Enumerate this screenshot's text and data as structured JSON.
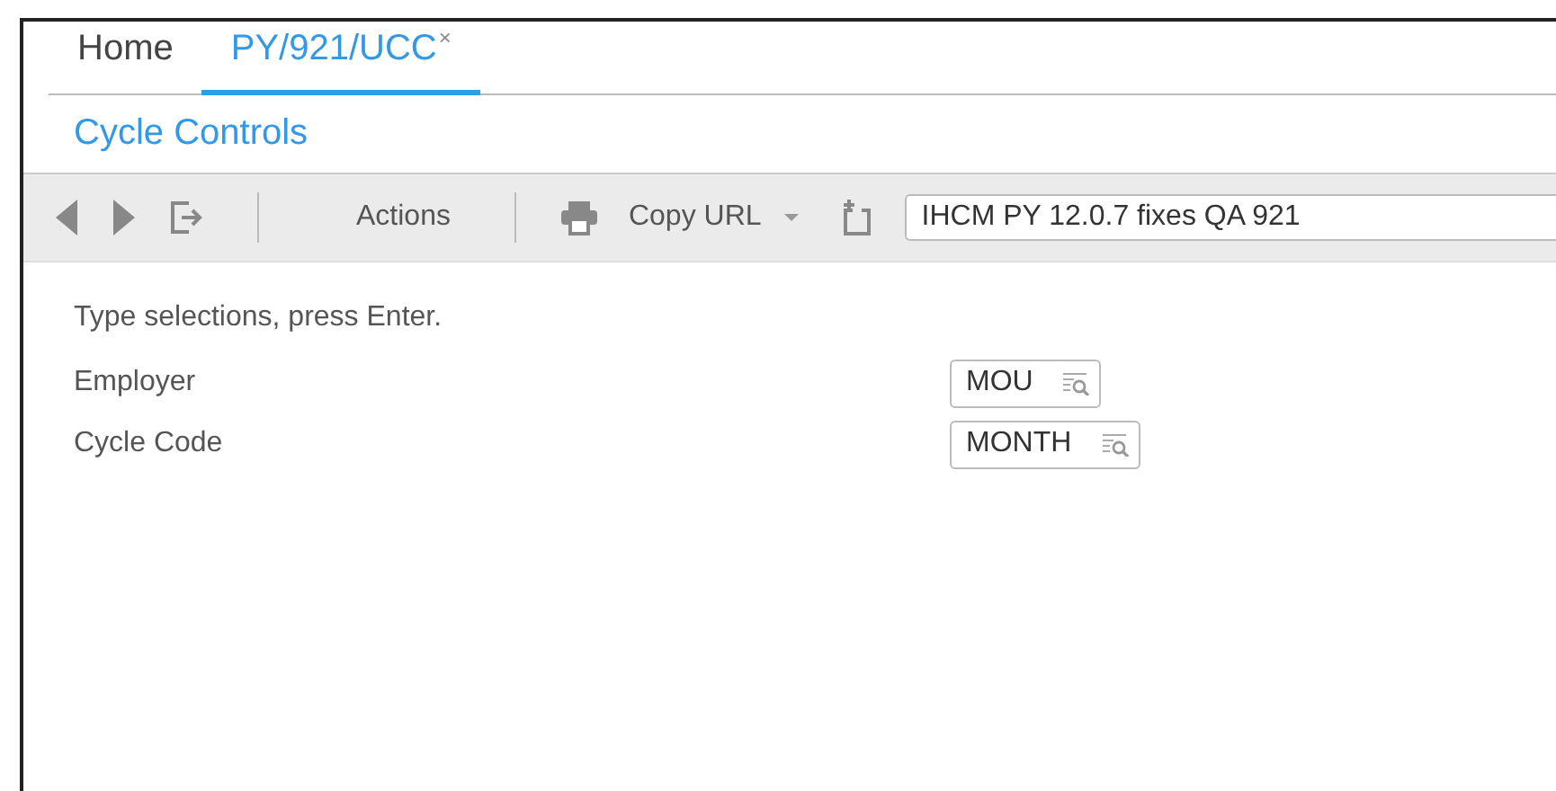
{
  "tabs": [
    {
      "label": "Home",
      "selected": false
    },
    {
      "label": "PY/921/UCC",
      "selected": true,
      "close": "×"
    }
  ],
  "page_title": "Cycle Controls",
  "toolbar": {
    "actions": "Actions",
    "copy_url": "Copy URL",
    "bookmark_value": "IHCM PY 12.0.7 fixes QA 921"
  },
  "form": {
    "instructions": "Type selections, press Enter.",
    "fields": [
      {
        "label": "Employer",
        "value": "MOU"
      },
      {
        "label": "Cycle Code",
        "value": "MONTH"
      }
    ]
  }
}
